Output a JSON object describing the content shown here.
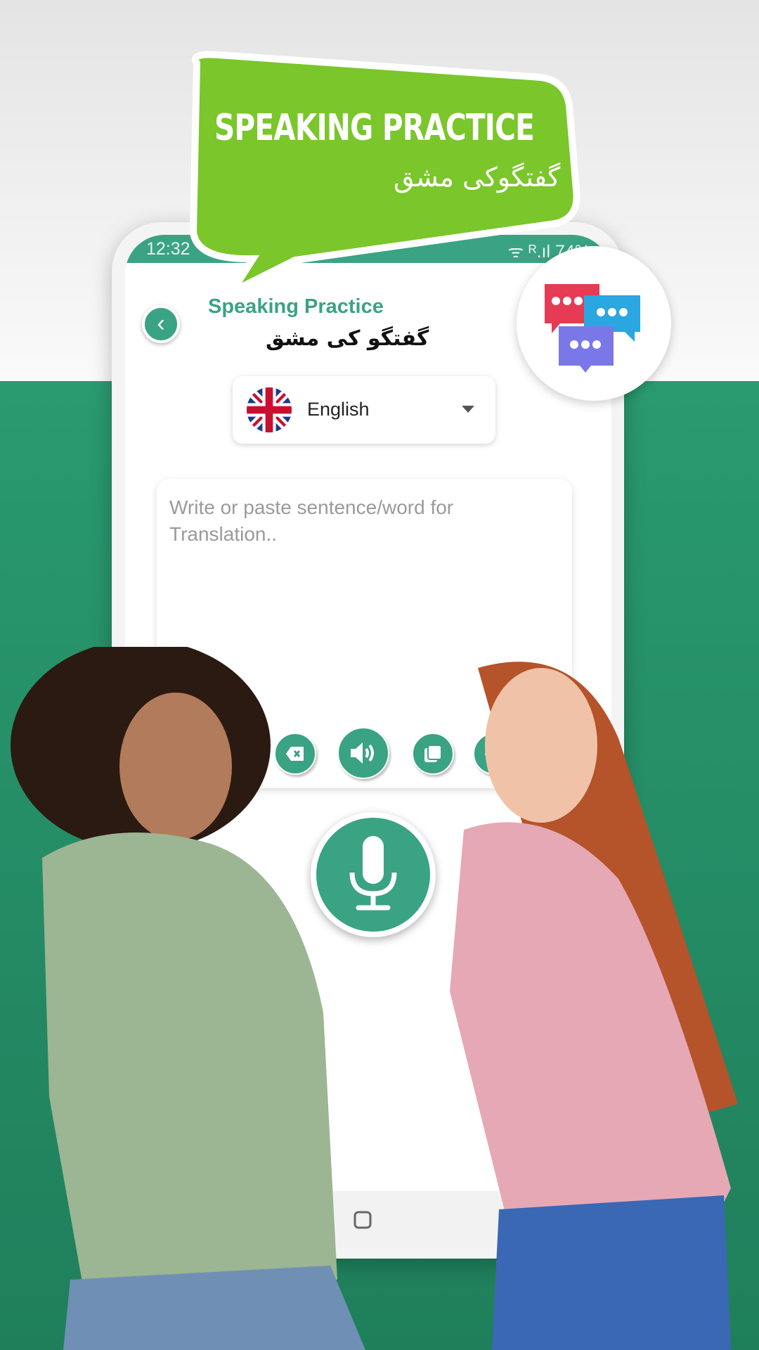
{
  "banner": {
    "title": "SPEAKING PRACTICE",
    "subtitle_ur": "گفتگوکی مشق",
    "bubble_color": "#7ac62b"
  },
  "status_bar": {
    "time": "12:32",
    "indicators": "ᯤ ᴿ.ıl 74%"
  },
  "header": {
    "title": "Speaking Practice",
    "title_ur": "گفتگو کی مشق",
    "back_icon": "chevron-left-icon"
  },
  "language_select": {
    "selected": "English",
    "flag": "uk-flag"
  },
  "input": {
    "placeholder": "Write or paste sentence/word for Translation.."
  },
  "actions": [
    {
      "name": "clear"
    },
    {
      "name": "speak"
    },
    {
      "name": "copy"
    },
    {
      "name": "share"
    }
  ],
  "colors": {
    "accent": "#3aa384",
    "background_green": "#238b65"
  }
}
